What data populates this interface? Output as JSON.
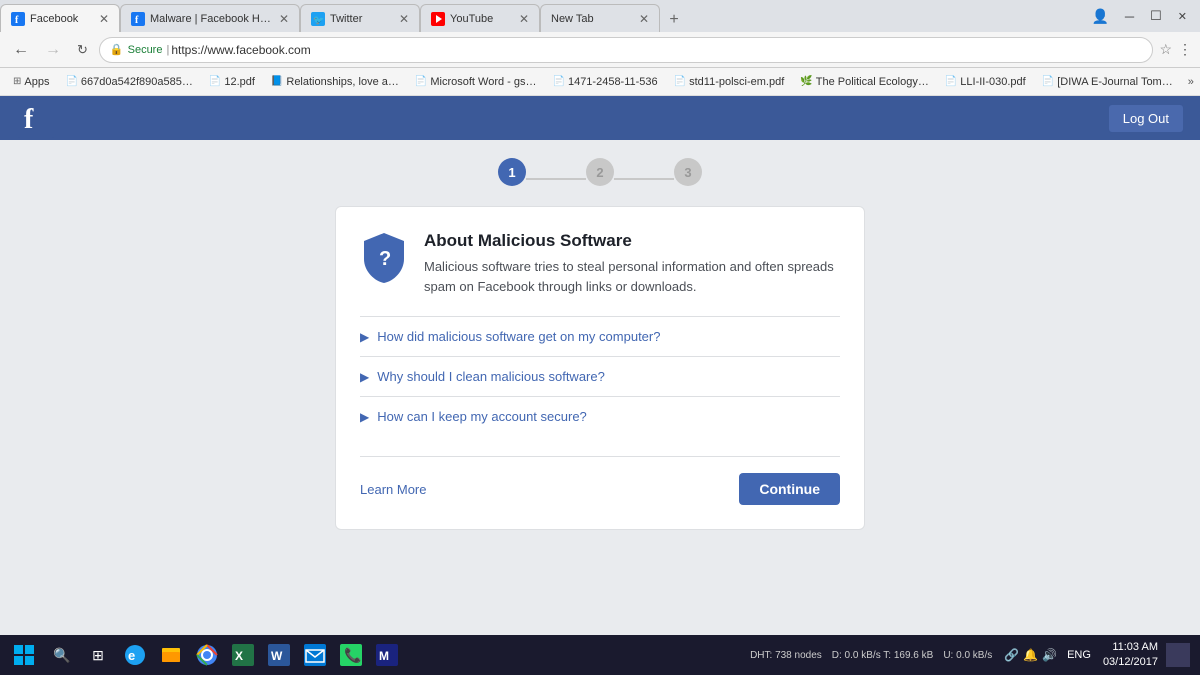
{
  "browser": {
    "tabs": [
      {
        "id": "tab-facebook",
        "title": "Facebook",
        "favicon": "fb",
        "active": true,
        "closeable": true
      },
      {
        "id": "tab-malware",
        "title": "Malware | Facebook Hel…",
        "favicon": "fb",
        "active": false,
        "closeable": true
      },
      {
        "id": "tab-twitter",
        "title": "Twitter",
        "favicon": "tw",
        "active": false,
        "closeable": true
      },
      {
        "id": "tab-youtube",
        "title": "YouTube",
        "favicon": "yt",
        "active": false,
        "closeable": true
      },
      {
        "id": "tab-newtab",
        "title": "New Tab",
        "favicon": "",
        "active": false,
        "closeable": true
      }
    ],
    "url": "https://www.facebook.com",
    "secure_label": "Secure",
    "bookmarks": [
      {
        "label": "Apps",
        "icon": "grid"
      },
      {
        "label": "667d0a542f890a585…",
        "icon": "doc"
      },
      {
        "label": "12.pdf",
        "icon": "doc"
      },
      {
        "label": "Relationships, love a…",
        "icon": "doc-blue"
      },
      {
        "label": "Microsoft Word - gs…",
        "icon": "doc"
      },
      {
        "label": "1471-2458-11-536",
        "icon": "doc"
      },
      {
        "label": "std11-polsci-em.pdf",
        "icon": "doc"
      },
      {
        "label": "The Political Ecology…",
        "icon": "leaf"
      },
      {
        "label": "LLI-II-030.pdf",
        "icon": "doc"
      },
      {
        "label": "[DIWA E-Journal Tom…",
        "icon": "doc"
      }
    ]
  },
  "facebook": {
    "logo": "f",
    "logout_label": "Log Out"
  },
  "progress": {
    "steps": [
      "1",
      "2",
      "3"
    ],
    "active_step": 0
  },
  "card": {
    "title": "About Malicious Software",
    "description": "Malicious software tries to steal personal information and often spreads spam on Facebook through links or downloads.",
    "faqs": [
      {
        "question": "How did malicious software get on my computer?"
      },
      {
        "question": "Why should I clean malicious software?"
      },
      {
        "question": "How can I keep my account secure?"
      }
    ],
    "learn_more_label": "Learn More",
    "continue_label": "Continue"
  },
  "taskbar": {
    "time": "11:03 AM",
    "date": "03/12/2017",
    "language": "ENG",
    "dht_label": "DHT: 738 nodes",
    "download_label": "D: 0.0 kB/s T: 169.6 kB",
    "upload_label": "U: 0.0 kB/s"
  }
}
